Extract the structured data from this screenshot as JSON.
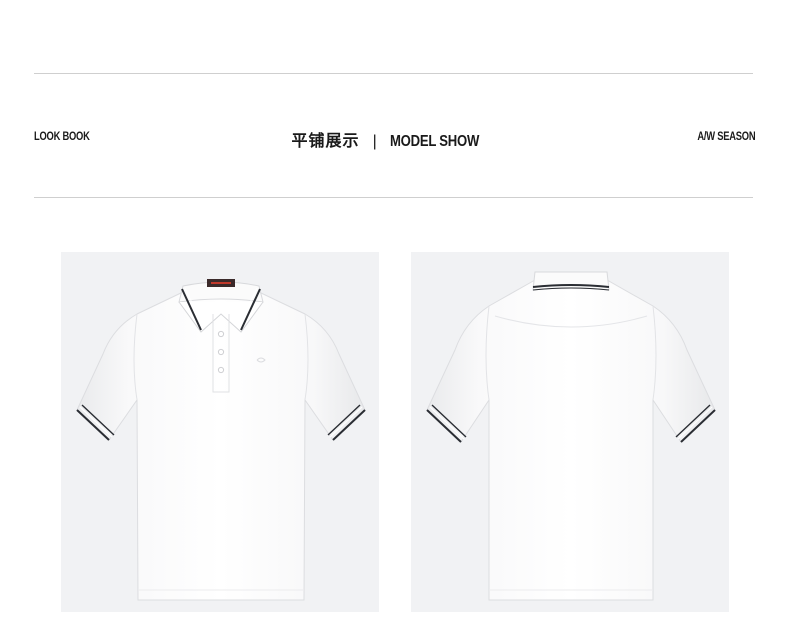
{
  "header": {
    "left_label": "LOOK BOOK",
    "title_cn": "平铺展示",
    "separator": "|",
    "title_en": "MODEL SHOW",
    "right_label": "A/W SEASON"
  },
  "images": [
    {
      "name": "polo-front",
      "subject": "white polo shirt front view",
      "trim_color": "#2a2d33",
      "background": "#f1f2f4"
    },
    {
      "name": "polo-back",
      "subject": "white polo shirt back view",
      "trim_color": "#2a2d33",
      "background": "#f1f2f4"
    }
  ]
}
